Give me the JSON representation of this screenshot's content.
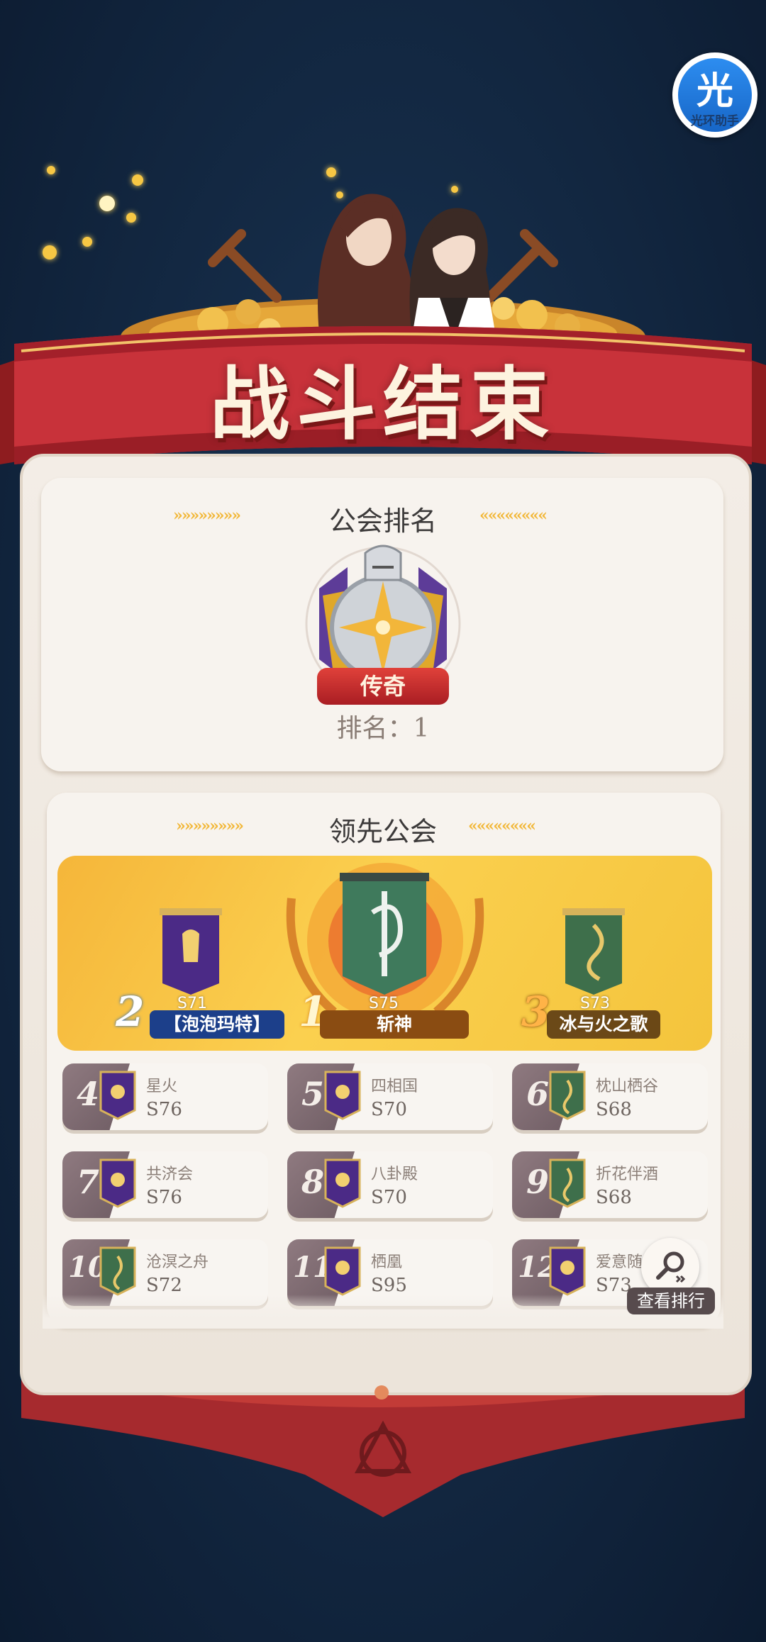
{
  "helper": {
    "glyph": "光",
    "label": "光环助手"
  },
  "banner": {
    "title": "战斗结束"
  },
  "guild_rank": {
    "section_title": "公会排名",
    "tier": "传奇",
    "rank_text": "排名：1"
  },
  "leaders": {
    "section_title": "领先公会",
    "podium": [
      {
        "place": "1",
        "server": "S75",
        "name": "斩神",
        "flag_color": "#3f7a5c"
      },
      {
        "place": "2",
        "server": "S71",
        "name": "【泡泡玛特】",
        "flag_color": "#4b2a86"
      },
      {
        "place": "3",
        "server": "S73",
        "name": "冰与火之歌",
        "flag_color": "#3e6f4b"
      }
    ],
    "list": [
      {
        "place": "4",
        "name": "星火",
        "server": "S76",
        "flag_color": "#4b2a86"
      },
      {
        "place": "5",
        "name": "四相国",
        "server": "S70",
        "flag_color": "#4b2a86"
      },
      {
        "place": "6",
        "name": "枕山栖谷",
        "server": "S68",
        "flag_color": "#3e6f4b"
      },
      {
        "place": "7",
        "name": "共济会",
        "server": "S76",
        "flag_color": "#4b2a86"
      },
      {
        "place": "8",
        "name": "八卦殿",
        "server": "S70",
        "flag_color": "#4b2a86"
      },
      {
        "place": "9",
        "name": "折花伴酒",
        "server": "S68",
        "flag_color": "#3e6f4b"
      },
      {
        "place": "10",
        "name": "沧溟之舟",
        "server": "S72",
        "flag_color": "#3e6f4b"
      },
      {
        "place": "11",
        "name": "栖凰",
        "server": "S95",
        "flag_color": "#4b2a86"
      },
      {
        "place": "12",
        "name": "爱意随",
        "server": "S73",
        "flag_color": "#4b2a86"
      }
    ],
    "view_button": "查看排行"
  }
}
